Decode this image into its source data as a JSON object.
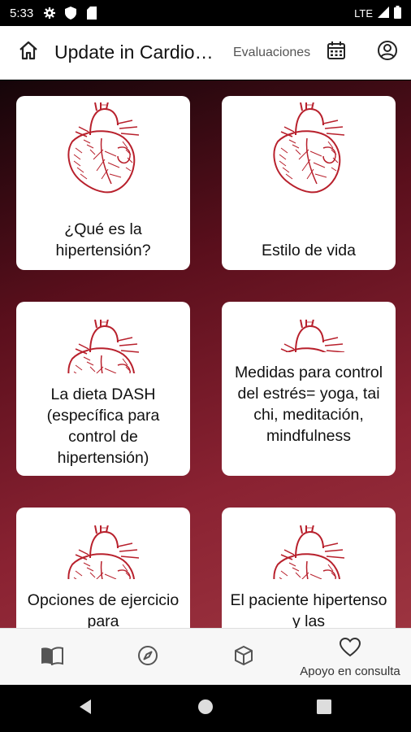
{
  "status_bar": {
    "time": "5:33",
    "network": "LTE",
    "icons": [
      "gear-icon",
      "shield-icon",
      "sd-card-icon",
      "signal-icon",
      "battery-icon"
    ]
  },
  "app_bar": {
    "title": "Update in Cardio…",
    "evaluations_label": "Evaluaciones",
    "icons": [
      "home-icon",
      "calendar-icon",
      "account-circle-icon"
    ]
  },
  "cards": [
    {
      "label": "¿Qué es la hipertensión?",
      "image": "heart-illustration-icon"
    },
    {
      "label": "Estilo de vida",
      "image": "heart-illustration-icon"
    },
    {
      "label": "La dieta DASH (específica para control de hipertensión)",
      "image": "heart-illustration-icon"
    },
    {
      "label": "Medidas para control del estrés= yoga, tai chi, meditación, mindfulness",
      "image": "heart-illustration-icon"
    },
    {
      "label": "Opciones de ejercicio para",
      "image": "heart-illustration-icon"
    },
    {
      "label": "El paciente hipertenso y las",
      "image": "heart-illustration-icon"
    }
  ],
  "bottom_nav": {
    "items": [
      {
        "icon": "book-icon",
        "label": ""
      },
      {
        "icon": "compass-icon",
        "label": ""
      },
      {
        "icon": "cube-icon",
        "label": ""
      },
      {
        "icon": "heart-outline-icon",
        "label": "Apoyo en consulta"
      }
    ]
  },
  "colors": {
    "gradient_dark": "#150509",
    "gradient_mid": "#5a0f1c",
    "gradient_light": "#9c3440",
    "heart_ink": "#b8202c"
  }
}
